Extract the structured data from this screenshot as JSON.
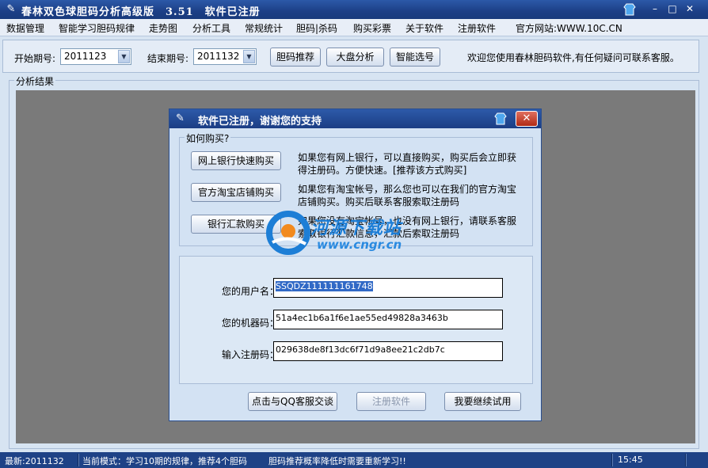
{
  "window": {
    "title": "春林双色球胆码分析高级版　3.51　软件已注册"
  },
  "menu": [
    "数据管理",
    "智能学习胆码规律",
    "走势图",
    "分析工具",
    "常规统计",
    "胆码|杀码",
    "购买彩票",
    "关于软件",
    "注册软件",
    "官方网站:WWW.10C.CN"
  ],
  "toolbar": {
    "start_label": "开始期号:",
    "start_value": "2011123",
    "end_label": "结束期号:",
    "end_value": "2011132",
    "btn_recommend": "胆码推荐",
    "btn_market": "大盘分析",
    "btn_smart": "智能选号",
    "welcome": "欢迎您使用春林胆码软件,有任何疑问可联系客服。"
  },
  "results_group": "分析结果",
  "dialog": {
    "title": "软件已注册，谢谢您的支持",
    "how_to_buy": "如何购买?",
    "buy_options": [
      {
        "button": "网上银行快速购买",
        "desc": "如果您有网上银行，可以直接购买，购买后会立即获得注册码。方便快速。[推荐该方式购买]"
      },
      {
        "button": "官方淘宝店铺购买",
        "desc": "如果您有淘宝帐号，那么您也可以在我们的官方淘宝店铺购买。购买后联系客服索取注册码"
      },
      {
        "button": "银行汇款购买",
        "desc": "如果您没有淘宝帐号，也没有网上银行，请联系客服索取银行汇款信息，汇款后索取注册码"
      }
    ],
    "username_label": "您的用户名：",
    "username_value": "SSQDZ111111161748",
    "machine_label": "您的机器码：",
    "machine_value": "51a4ec1b6a1f6e1ae55ed49828a3463b",
    "regcode_label": "输入注册码：",
    "regcode_value": "029638de8f13dc6f71d9a8ee21c2db7c",
    "btn_qq": "点击与QQ客服交谈",
    "btn_register": "注册软件",
    "btn_trial": "我要继续试用"
  },
  "watermark": {
    "cn": "河源下载站",
    "url": "www.cngr.cn"
  },
  "status": {
    "latest": "最新:2011132",
    "mode": "当前模式：学习10期的规律，推荐4个胆码",
    "hint": "胆码推荐概率降低时需要重新学习!!",
    "time": "15:45"
  },
  "colors": {
    "titlebar": "#1c3f86",
    "statusbar": "#1e4286",
    "close_red": "#b02a16",
    "watermark_blue": "#1d7ed6"
  }
}
